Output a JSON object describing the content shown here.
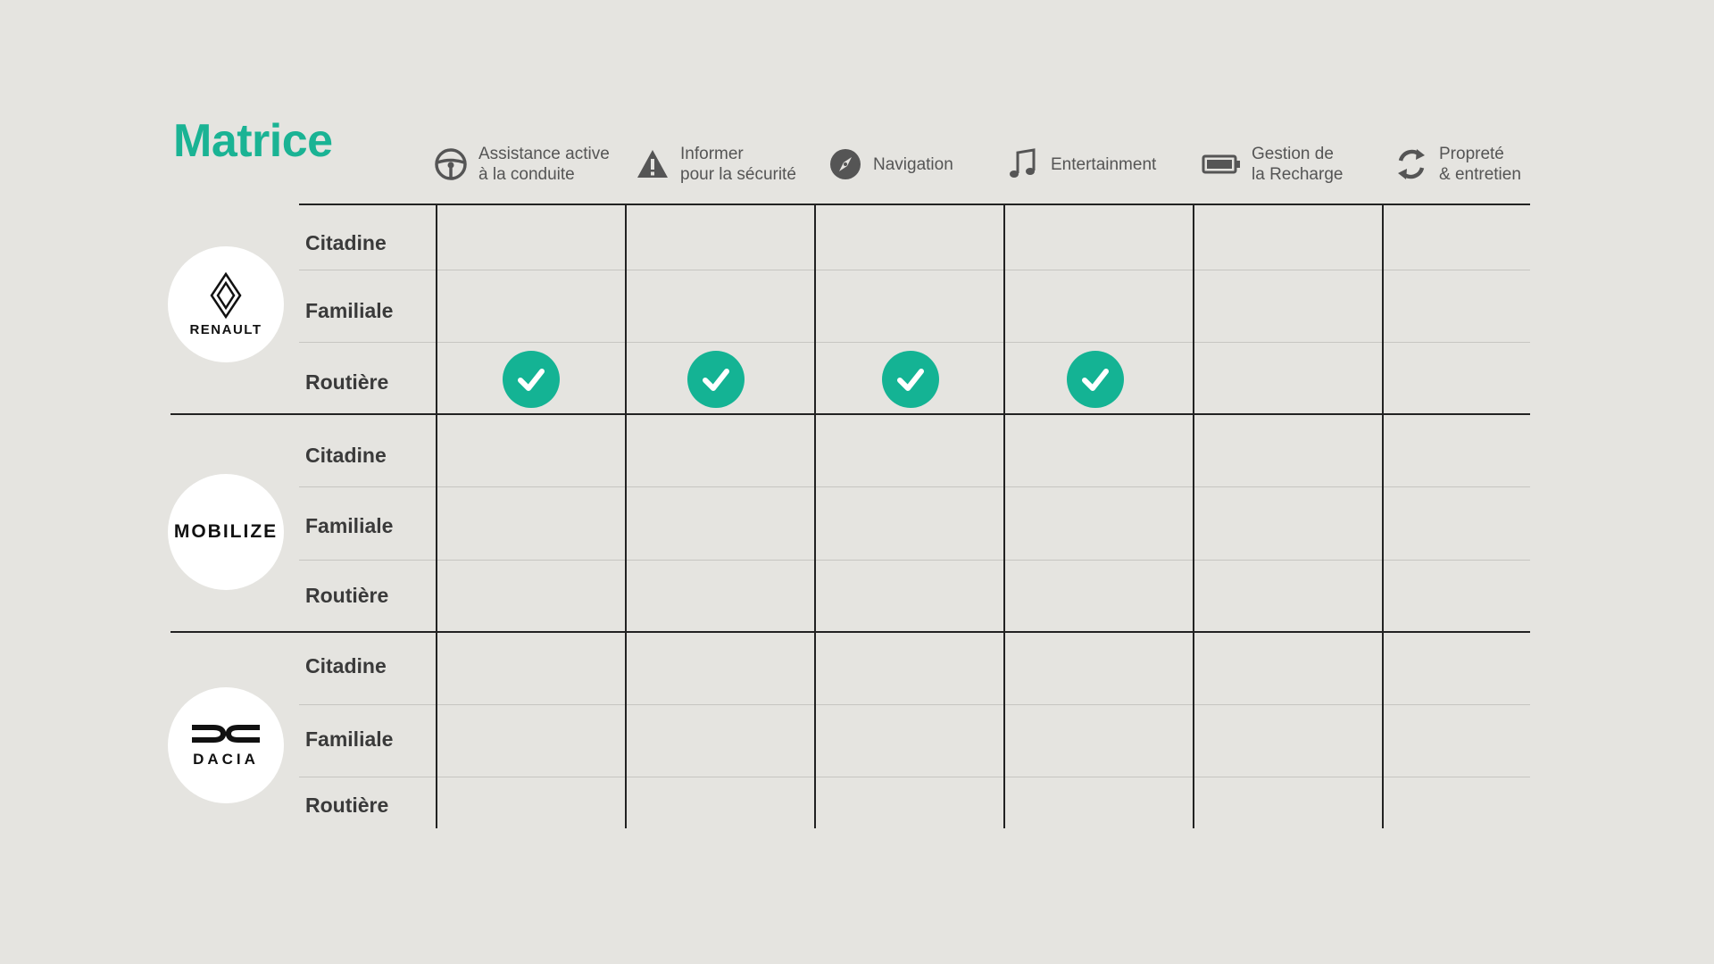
{
  "title": "Matrice",
  "accent_color": "#1ab394",
  "columns": [
    {
      "label": "Assistance active\nà la conduite",
      "icon": "steering-wheel-icon"
    },
    {
      "label": "Informer\npour la sécurité",
      "icon": "warning-icon"
    },
    {
      "label": "Navigation",
      "icon": "compass-icon"
    },
    {
      "label": "Entertainment",
      "icon": "music-note-icon"
    },
    {
      "label": "Gestion de\nla Recharge",
      "icon": "battery-icon"
    },
    {
      "label": "Propreté\n& entretien",
      "icon": "recycle-icon"
    }
  ],
  "brands": [
    {
      "name": "RENAULT",
      "logo": "renault-logo",
      "rows": [
        {
          "label": "Citadine",
          "checks": [
            false,
            false,
            false,
            false,
            false,
            false
          ]
        },
        {
          "label": "Familiale",
          "checks": [
            false,
            false,
            false,
            false,
            false,
            false
          ]
        },
        {
          "label": "Routière",
          "checks": [
            true,
            true,
            true,
            true,
            false,
            false
          ]
        }
      ]
    },
    {
      "name": "MOBILIZE",
      "logo": "mobilize-logo",
      "rows": [
        {
          "label": "Citadine",
          "checks": [
            false,
            false,
            false,
            false,
            false,
            false
          ]
        },
        {
          "label": "Familiale",
          "checks": [
            false,
            false,
            false,
            false,
            false,
            false
          ]
        },
        {
          "label": "Routière",
          "checks": [
            false,
            false,
            false,
            false,
            false,
            false
          ]
        }
      ]
    },
    {
      "name": "DACIA",
      "logo": "dacia-logo",
      "rows": [
        {
          "label": "Citadine",
          "checks": [
            false,
            false,
            false,
            false,
            false,
            false
          ]
        },
        {
          "label": "Familiale",
          "checks": [
            false,
            false,
            false,
            false,
            false,
            false
          ]
        },
        {
          "label": "Routière",
          "checks": [
            false,
            false,
            false,
            false,
            false,
            false
          ]
        }
      ]
    }
  ]
}
